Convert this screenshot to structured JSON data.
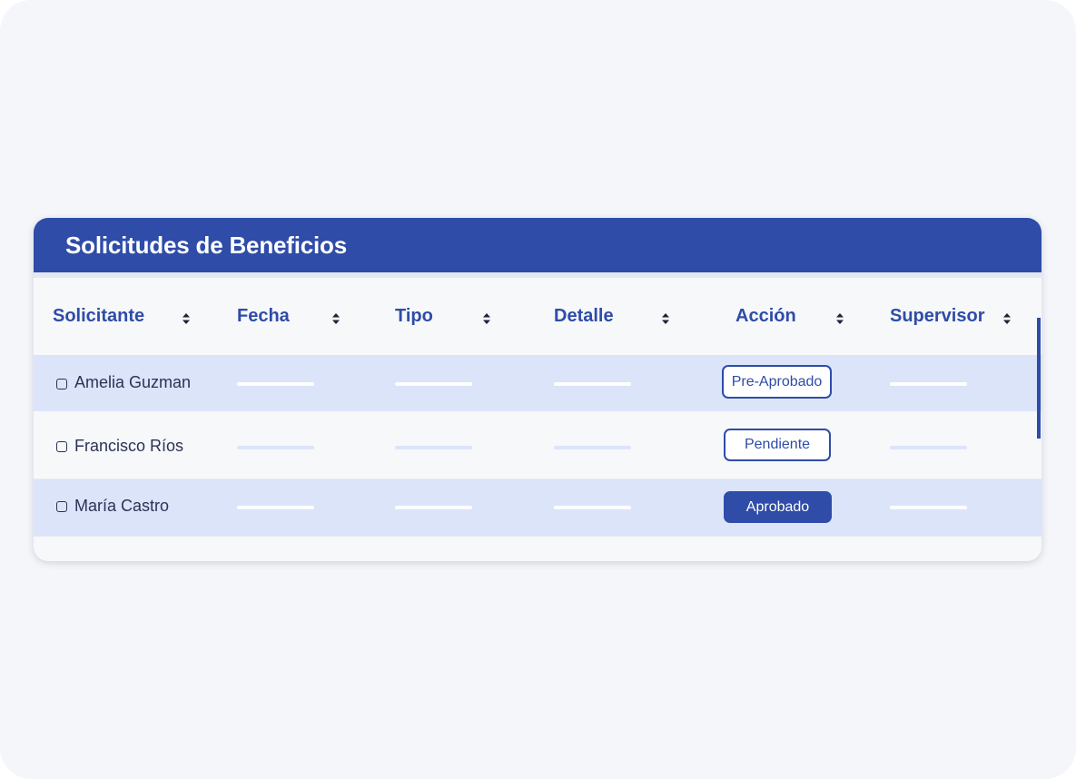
{
  "panel": {
    "title": "Solicitudes de Beneficios"
  },
  "columns": [
    {
      "label": "Solicitante",
      "sort_icon": "sort-updown-icon"
    },
    {
      "label": "Fecha",
      "sort_icon": "sort-updown-icon"
    },
    {
      "label": "Tipo",
      "sort_icon": "sort-updown-icon"
    },
    {
      "label": "Detalle",
      "sort_icon": "sort-updown-icon"
    },
    {
      "label": "Acción",
      "sort_icon": "sort-updown-icon"
    },
    {
      "label": "Supervisor",
      "sort_icon": "sort-updown-icon"
    }
  ],
  "rows": [
    {
      "name": "Amelia Guzman",
      "status": "Pre-Aprobado",
      "status_style": "outline",
      "highlighted": true
    },
    {
      "name": "Francisco Ríos",
      "status": "Pendiente",
      "status_style": "outline",
      "highlighted": false
    },
    {
      "name": "María Castro",
      "status": "Aprobado",
      "status_style": "filled",
      "highlighted": true
    }
  ],
  "colors": {
    "accent": "#2e4ca8",
    "row_highlight": "#dbe4f9",
    "background": "#f4f6fa",
    "text": "#2b3355"
  }
}
